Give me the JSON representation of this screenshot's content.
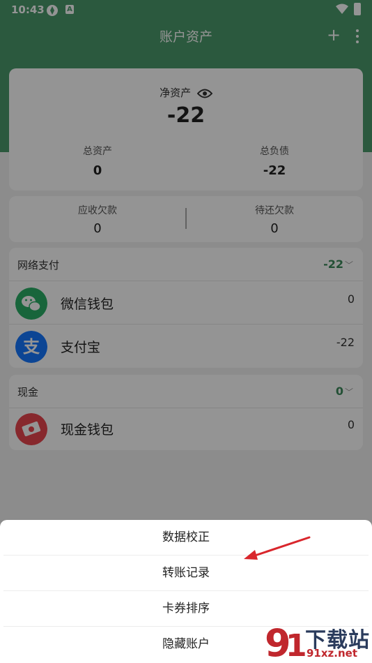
{
  "status_bar": {
    "time": "10:43",
    "icon2_letter": "A"
  },
  "header": {
    "title": "账户资产",
    "add_label": "+"
  },
  "summary": {
    "net_label": "净资产",
    "net_value": "-22",
    "total_assets_label": "总资产",
    "total_assets_value": "0",
    "total_liabilities_label": "总负债",
    "total_liabilities_value": "-22"
  },
  "receivables": {
    "receivable_label": "应收欠款",
    "receivable_value": "0",
    "payable_label": "待还欠款",
    "payable_value": "0"
  },
  "groups": [
    {
      "name": "网络支付",
      "total": "-22",
      "accounts": [
        {
          "name": "微信钱包",
          "value": "0",
          "icon": "wechat-icon",
          "color": "#2aae67"
        },
        {
          "name": "支付宝",
          "value": "-22",
          "icon": "alipay-icon",
          "color": "#1677ff"
        }
      ]
    },
    {
      "name": "现金",
      "total": "0",
      "accounts": [
        {
          "name": "现金钱包",
          "value": "0",
          "icon": "cash-icon",
          "color": "#e8454f"
        }
      ]
    }
  ],
  "sheet": {
    "items": [
      "数据校正",
      "转账记录",
      "卡券排序",
      "隐藏账户"
    ]
  },
  "watermark": {
    "brand": "下载站",
    "site": "91xz.net"
  },
  "colors": {
    "accent": "#4a9a6b",
    "total_green": "#3d8a5c",
    "arrow_red": "#d9262c"
  }
}
